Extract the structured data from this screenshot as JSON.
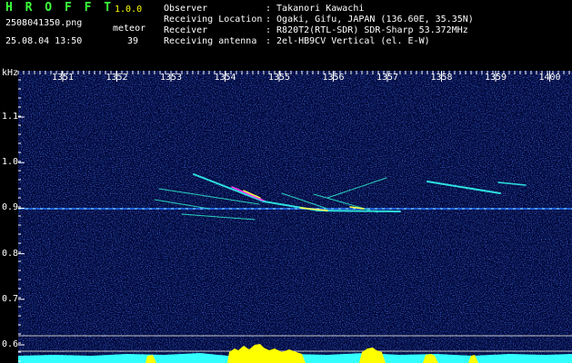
{
  "header": {
    "app_name": "H R O F F T",
    "version": "1.0.0",
    "filename": "2508041350.png",
    "datetime": "25.08.04 13:50",
    "meteor_label": "meteor",
    "meteor_count": "39"
  },
  "info": {
    "labels": [
      "Observer",
      "Receiving Location",
      "Receiver",
      "Receiving antenna"
    ],
    "values": [
      ": Takanori Kawachi",
      ": Ogaki, Gifu, JAPAN (136.60E, 35.35N)",
      ": R820T2(RTL-SDR) SDR-Sharp 53.372MHz",
      ": 2el-HB9CV Vertical (el. E-W)"
    ]
  },
  "axis": {
    "unit": "kHz",
    "x_ticks": [
      "1351",
      "1352",
      "1353",
      "1354",
      "1355",
      "1356",
      "1357",
      "1358",
      "1359",
      "1400"
    ],
    "y_ticks": [
      "1.1",
      "1.0",
      "0.9",
      "0.8",
      "0.7",
      "0.6"
    ]
  },
  "colors": {
    "background": "#000000",
    "noise": "#0b1f9e",
    "label_green": "#3cff3c",
    "signal_cyan": "#33ffff",
    "signal_yellow": "#ffff00"
  }
}
